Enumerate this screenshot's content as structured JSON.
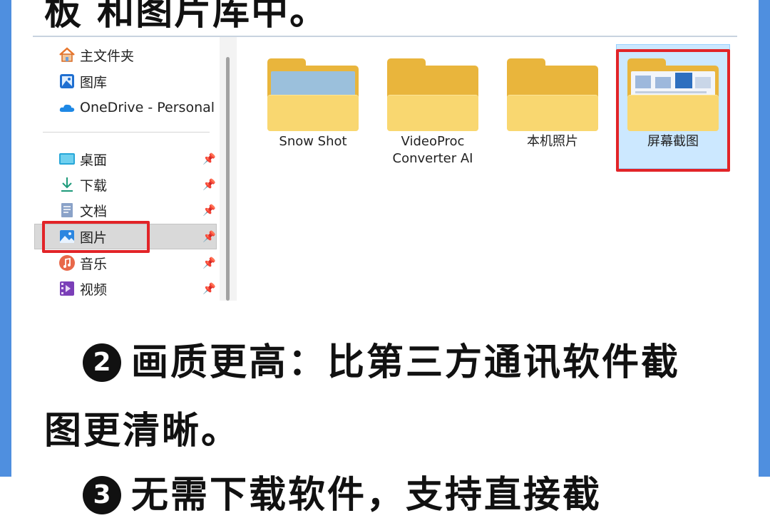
{
  "caption_top": "板 和图片库中。",
  "explorer": {
    "nav_items": [
      {
        "label": "主文件夹",
        "icon": "home-icon"
      },
      {
        "label": "图库",
        "icon": "gallery-icon"
      },
      {
        "label": "OneDrive - Personal",
        "icon": "onedrive-cloud-icon"
      }
    ],
    "quick_access": [
      {
        "label": "桌面",
        "icon": "desktop-icon"
      },
      {
        "label": "下载",
        "icon": "download-icon"
      },
      {
        "label": "文档",
        "icon": "document-icon"
      },
      {
        "label": "图片",
        "icon": "pictures-icon"
      },
      {
        "label": "音乐",
        "icon": "music-icon"
      },
      {
        "label": "视频",
        "icon": "video-icon"
      }
    ],
    "pin_glyph": "📌",
    "folders": [
      {
        "label": "Snow Shot"
      },
      {
        "label": "VideoProc Converter AI"
      },
      {
        "label": "本机照片"
      },
      {
        "label": "屏幕截图"
      }
    ]
  },
  "point2": {
    "number": "2",
    "line1": "画质更高：比第三方通讯软件截",
    "line2": "图更清晰。"
  },
  "point3_partial": {
    "number": "3",
    "text": "无需下载软件，支持直接截"
  },
  "colors": {
    "frame": "#4f8fdf",
    "highlight": "#e22428",
    "folder": "#f9d770",
    "selected_tile": "#cce8ff"
  }
}
